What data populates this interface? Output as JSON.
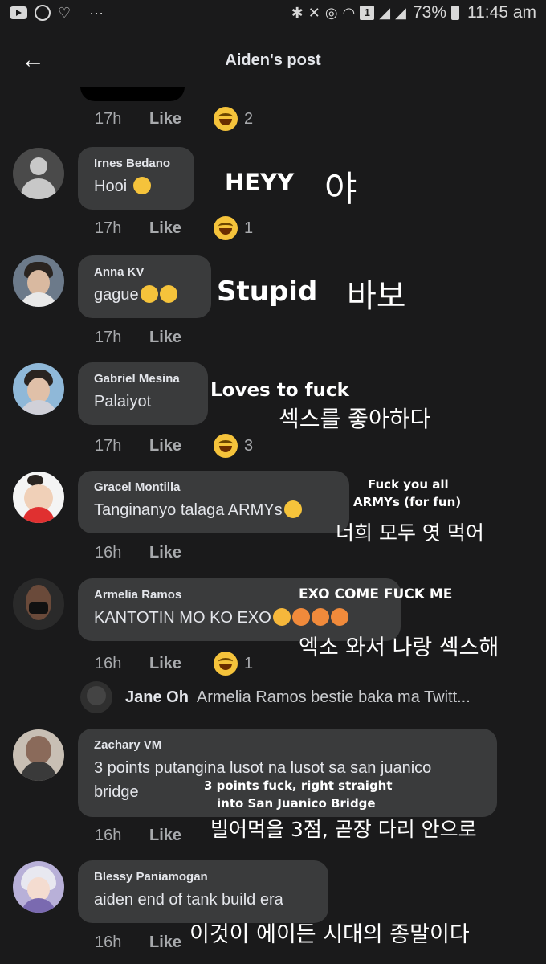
{
  "status_bar": {
    "icons_left": [
      "youtube-icon",
      "messenger-icon",
      "heart-icon",
      "more-icon"
    ],
    "more": "···",
    "battery": "73%",
    "time": "11:45 am",
    "sim_badge": "1"
  },
  "header": {
    "title": "Aiden's post",
    "back_icon": "←"
  },
  "top_meta": {
    "time": "17h",
    "like": "Like",
    "reactions": "2"
  },
  "comments": [
    {
      "name": "Irnes Bedano",
      "text": "Hooi",
      "emojis": [
        "cry"
      ],
      "time": "17h",
      "like": "Like",
      "reactions": "1"
    },
    {
      "name": "Anna KV",
      "text": "gague",
      "emojis": [
        "cry",
        "laugh"
      ],
      "time": "17h",
      "like": "Like",
      "reactions": ""
    },
    {
      "name": "Gabriel Mesina",
      "text": "Palaiyot",
      "emojis": [],
      "time": "17h",
      "like": "Like",
      "reactions": "3"
    },
    {
      "name": "Gracel Montilla",
      "text": "Tanginanyo talaga ARMYs",
      "emojis": [
        "cry"
      ],
      "time": "16h",
      "like": "Like",
      "reactions": ""
    },
    {
      "name": "Armelia Ramos",
      "text": "KANTOTIN MO KO EXO",
      "emojis": [
        "shock",
        "sad",
        "sad",
        "sad"
      ],
      "time": "16h",
      "like": "Like",
      "reactions": "1"
    },
    {
      "name": "Zachary VM",
      "text_line1": "3 points putangina lusot na lusot sa san juanico",
      "text_line2": "bridge",
      "time": "16h",
      "like": "Like",
      "reactions": ""
    },
    {
      "name": "Blessy Paniamogan",
      "text": "aiden end of tank build era",
      "time": "16h",
      "like": "Like",
      "reactions": ""
    }
  ],
  "reply": {
    "name": "Jane Oh",
    "text": "Armelia Ramos bestie baka ma Twitt..."
  },
  "overlays": {
    "o1_en": "HEYY",
    "o1_kr": "야",
    "o2_en": "Stupid",
    "o2_kr": "바보",
    "o3_en": "Loves to fuck",
    "o3_kr": "섹스를 좋아하다",
    "o4_en1": "Fuck you all",
    "o4_en2": "ARMYs (for fun)",
    "o4_kr": "너희 모두 엿 먹어",
    "o5_en": "EXO COME FUCK ME",
    "o5_kr": "엑소 와서 나랑 섹스해",
    "o6_en1": "3 points fuck, right straight",
    "o6_en2": "into San Juanico Bridge",
    "o6_kr": "빌어먹을 3점, 곧장 다리 안으로",
    "o7_kr": "이것이 에이든 시대의 종말이다"
  }
}
